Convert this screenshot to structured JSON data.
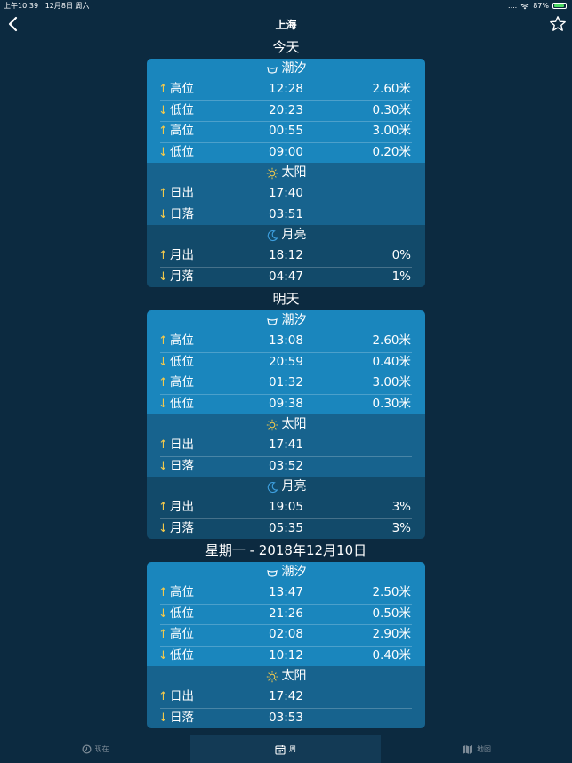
{
  "status": {
    "time": "上午10:39",
    "date": "12月8日 周六",
    "signal": "....",
    "battery": "87%"
  },
  "nav": {
    "title": "上海"
  },
  "days": [
    {
      "title": "今天",
      "tide": {
        "header": "潮汐",
        "rows": [
          {
            "dir": "up",
            "label": "高位",
            "time": "12:28",
            "value": "2.60米"
          },
          {
            "dir": "down",
            "label": "低位",
            "time": "20:23",
            "value": "0.30米"
          },
          {
            "dir": "up",
            "label": "高位",
            "time": "00:55",
            "value": "3.00米"
          },
          {
            "dir": "down",
            "label": "低位",
            "time": "09:00",
            "value": "0.20米"
          }
        ]
      },
      "sun": {
        "header": "太阳",
        "rows": [
          {
            "dir": "up",
            "label": "日出",
            "time": "17:40",
            "value": ""
          },
          {
            "dir": "down",
            "label": "日落",
            "time": "03:51",
            "value": ""
          }
        ]
      },
      "moon": {
        "header": "月亮",
        "rows": [
          {
            "dir": "up",
            "label": "月出",
            "time": "18:12",
            "value": "0%"
          },
          {
            "dir": "down",
            "label": "月落",
            "time": "04:47",
            "value": "1%"
          }
        ]
      }
    },
    {
      "title": "明天",
      "tide": {
        "header": "潮汐",
        "rows": [
          {
            "dir": "up",
            "label": "高位",
            "time": "13:08",
            "value": "2.60米"
          },
          {
            "dir": "down",
            "label": "低位",
            "time": "20:59",
            "value": "0.40米"
          },
          {
            "dir": "up",
            "label": "高位",
            "time": "01:32",
            "value": "3.00米"
          },
          {
            "dir": "down",
            "label": "低位",
            "time": "09:38",
            "value": "0.30米"
          }
        ]
      },
      "sun": {
        "header": "太阳",
        "rows": [
          {
            "dir": "up",
            "label": "日出",
            "time": "17:41",
            "value": ""
          },
          {
            "dir": "down",
            "label": "日落",
            "time": "03:52",
            "value": ""
          }
        ]
      },
      "moon": {
        "header": "月亮",
        "rows": [
          {
            "dir": "up",
            "label": "月出",
            "time": "19:05",
            "value": "3%"
          },
          {
            "dir": "down",
            "label": "月落",
            "time": "05:35",
            "value": "3%"
          }
        ]
      }
    },
    {
      "title": "星期一 - 2018年12月10日",
      "tide": {
        "header": "潮汐",
        "rows": [
          {
            "dir": "up",
            "label": "高位",
            "time": "13:47",
            "value": "2.50米"
          },
          {
            "dir": "down",
            "label": "低位",
            "time": "21:26",
            "value": "0.50米"
          },
          {
            "dir": "up",
            "label": "高位",
            "time": "02:08",
            "value": "2.90米"
          },
          {
            "dir": "down",
            "label": "低位",
            "time": "10:12",
            "value": "0.40米"
          }
        ]
      },
      "sun": {
        "header": "太阳",
        "rows": [
          {
            "dir": "up",
            "label": "日出",
            "time": "17:42",
            "value": ""
          },
          {
            "dir": "down",
            "label": "日落",
            "time": "03:53",
            "value": ""
          }
        ]
      }
    }
  ],
  "arrows": {
    "up": "↑",
    "down": "↓"
  },
  "tabs": [
    {
      "label": "现在",
      "icon": "clock-icon"
    },
    {
      "label": "周",
      "icon": "calendar-icon"
    },
    {
      "label": "地图",
      "icon": "map-icon"
    }
  ],
  "colors": {
    "background": "#0c2a40",
    "tide": "#1a86bd",
    "sun": "#17638e",
    "moon": "#124a6a",
    "arrow": "#f2c94c"
  }
}
